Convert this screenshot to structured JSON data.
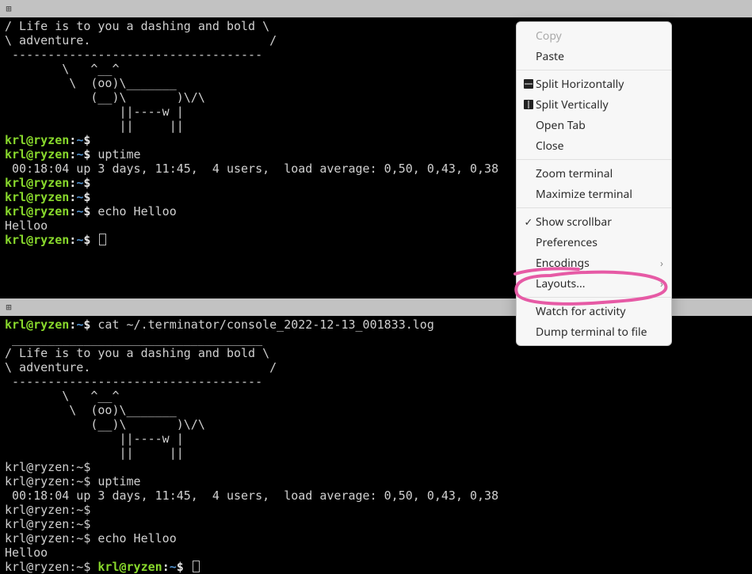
{
  "prompt": {
    "user": "krl@ryzen",
    "sep": ":",
    "path": "~",
    "dollar": "$"
  },
  "pane1": {
    "ascii": "/ Life is to you a dashing and bold \\\n\\ adventure.                         /\n -----------------------------------\n        \\   ^__^\n         \\  (oo)\\_______\n            (__)\\       )\\/\\\n                ||----w |\n                ||     ||",
    "lines": {
      "uptime_cmd": "uptime",
      "uptime_out": " 00:18:04 up 3 days, 11:45,  4 users,  load average: 0,50, 0,43, 0,38",
      "echo_cmd": "echo Helloo",
      "echo_out": "Helloo"
    }
  },
  "pane2": {
    "cat_cmd": "cat ~/.terminator/console_2022-12-13_001833.log",
    "ascii_top": " ___________________________________ \n/ Life is to you a dashing and bold \\\n\\ adventure.                         /\n -----------------------------------\n        \\   ^__^\n         \\  (oo)\\_______\n            (__)\\       )\\/\\\n                ||----w |\n                ||     ||",
    "lines": {
      "uptime_cmd": "uptime",
      "uptime_out": " 00:18:04 up 3 days, 11:45,  4 users,  load average: 0,50, 0,43, 0,38",
      "echo_cmd": "echo Helloo",
      "echo_out": "Helloo"
    },
    "trailing_prompt": {
      "user": "krl@ryzen",
      "sep": ":",
      "path": "~",
      "dollar": "$"
    }
  },
  "menu": {
    "copy": "Copy",
    "paste": "Paste",
    "split_h": "Split Horizontally",
    "split_v": "Split Vertically",
    "open_tab": "Open Tab",
    "close": "Close",
    "zoom": "Zoom terminal",
    "maximize": "Maximize terminal",
    "show_scrollbar": "Show scrollbar",
    "preferences": "Preferences",
    "encodings": "Encodings",
    "layouts": "Layouts...",
    "watch": "Watch for activity",
    "dump": "Dump terminal to file"
  }
}
